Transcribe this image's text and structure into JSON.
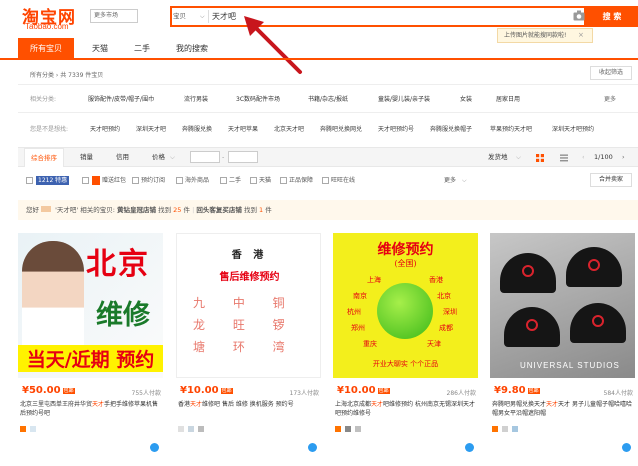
{
  "header": {
    "logo_cn": "淘宝网",
    "logo_en": "Taobao.com",
    "market_label": "更多市场",
    "search_category": "宝贝",
    "search_query": "天才吧",
    "search_button": "搜 索",
    "image_search_tip": "上传图片就能搜同款啦!"
  },
  "tabs": [
    {
      "label": "所有宝贝"
    },
    {
      "label": "天猫"
    },
    {
      "label": "二手"
    },
    {
      "label": "我的搜索"
    }
  ],
  "crumb": "所有分类 › 共 7339 件宝贝",
  "fold_label": "收起筛选",
  "related_row": {
    "label": "相关分类:",
    "items": [
      "服饰配件/皮带/帽子/围巾",
      "流行男装",
      "3C数码配件市场",
      "书籍/杂志/报纸",
      "童装/婴儿装/亲子装",
      "女装",
      "居家日用"
    ],
    "more": "更多"
  },
  "search_row": {
    "label": "您是不是想找:",
    "items": [
      "天才吧预约",
      "深圳天才吧",
      "奔腾服兑换",
      "天才吧苹果",
      "北京天才吧",
      "奔腾吧兑换网兑",
      "天才吧预约号",
      "奔腾服兑换帽子",
      "苹果预约天才吧",
      "深圳天才吧预约"
    ]
  },
  "sort": {
    "items": [
      "综合排序",
      "销量",
      "信用",
      "价格"
    ],
    "ship_from": "发货地",
    "pager": "1/100"
  },
  "filters": {
    "items": [
      "1212 特惠",
      "赠送红包",
      "预约订阅",
      "海外商品",
      "二手",
      "天猫",
      "正品保障",
      "旺旺在线"
    ],
    "more": "更多",
    "merge": "合并卖家"
  },
  "notice": {
    "prefix": "您好",
    "keyword": "'天才吧' 相关的宝贝:",
    "store_label": "黄钻皇冠店铺",
    "store_count_prefix": "找到",
    "store_count": "25",
    "unit": "件",
    "sep": "|",
    "buyer_label": "回头客复买店铺",
    "buyer_count_prefix": "找到",
    "buyer_count": "1"
  },
  "products": [
    {
      "price": "¥50.00",
      "tag": "包邮",
      "buyers": "755人付款",
      "title_pre": "北京三里屯西单王府井华贸",
      "title_hl": "天才",
      "title_post": "手把手维修苹果机售后预约号吧",
      "img_big1": "北京",
      "img_big2": "维修",
      "img_big3": "当天/近期 预约"
    },
    {
      "price": "¥10.00",
      "tag": "包邮",
      "buyers": "173人付款",
      "title_pre": "香港",
      "title_hl": "天才",
      "title_post": "维修吧 售后 维修 换机服务 预约号",
      "img_l1": "香 港",
      "img_l2": "售后维修预约",
      "img_l3": "九 中 铜",
      "img_l4": "龙 旺 锣",
      "img_l5": "塘 环 湾"
    },
    {
      "price": "¥10.00",
      "tag": "包邮",
      "buyers": "286人付款",
      "title_pre": "上海北京成都",
      "title_hl": "天才",
      "title_post": "吧维修预约 杭州南京无锡深圳天才吧预约维修号",
      "img_title": "维修预约",
      "img_sub": "(全国)",
      "img_cities": [
        "上海",
        "香港",
        "南京",
        "北京",
        "杭州",
        "深圳",
        "郑州",
        "成都",
        "重庆",
        "天津"
      ],
      "img_foot": "开业大聊实  个个正品"
    },
    {
      "price": "¥9.80",
      "tag": "包邮",
      "buyers": "584人付款",
      "title_pre": "奔腾吧男帽兑换天才",
      "title_hl": "天才",
      "title_post": "天才 男子儿童帽子帽哈嘻哈帽男女平沿帽遮阳帽",
      "img_text": "UNIVERSAL STUDIOS"
    }
  ],
  "colors": {
    "brand": "#ff5000",
    "price": "#ff4400"
  }
}
